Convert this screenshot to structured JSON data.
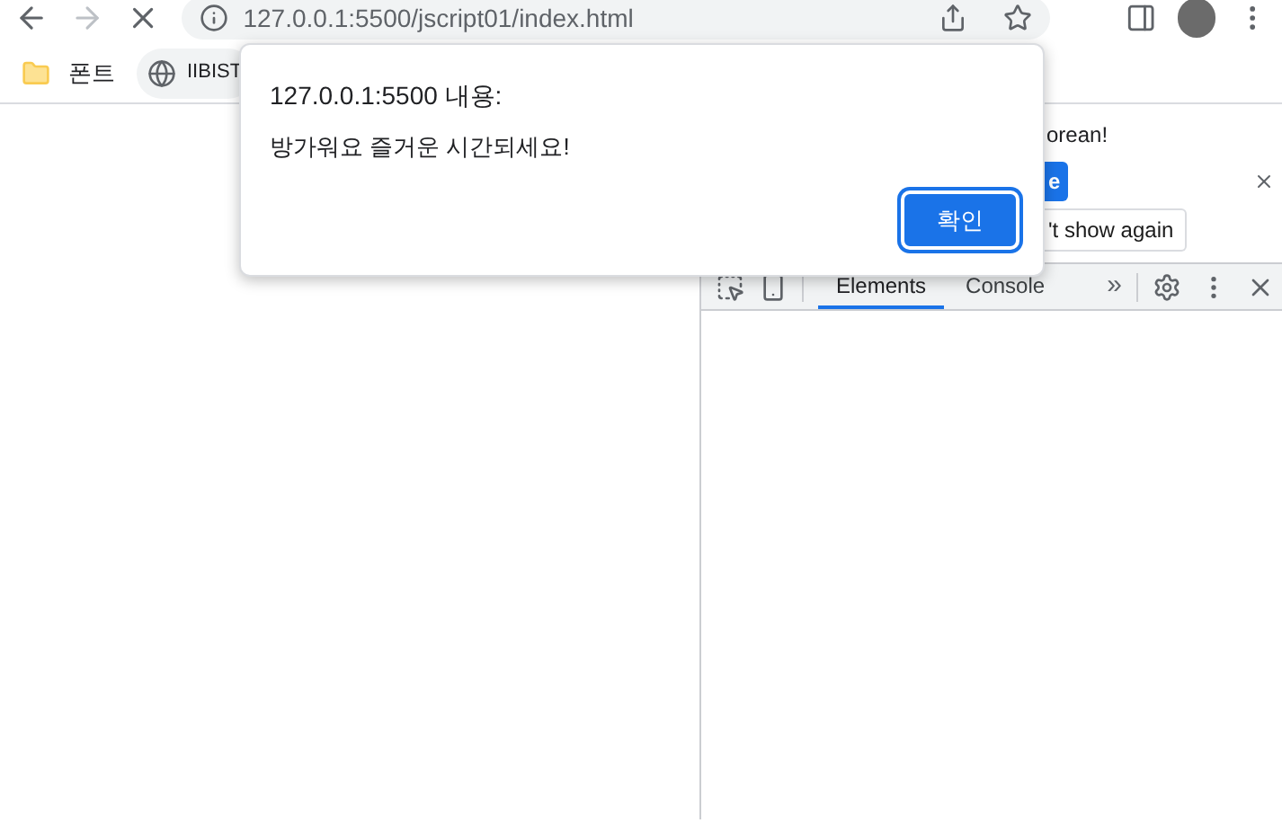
{
  "browser": {
    "address": "127.0.0.1:5500/jscript01/index.html",
    "bookmarks": [
      {
        "label": "폰트",
        "kind": "folder"
      },
      {
        "label": "IIBIST",
        "kind": "site"
      }
    ]
  },
  "devtools": {
    "banner": {
      "text": "orean!",
      "primary_button": "e",
      "secondary_button": "'t show again"
    },
    "tabs": [
      {
        "label": "Elements",
        "selected": true
      },
      {
        "label": "Console",
        "selected": false
      }
    ],
    "more": "»"
  },
  "dialog": {
    "title": "127.0.0.1:5500 내용:",
    "message": "방가워요 즐거운 시간되세요!",
    "button": "확인"
  }
}
